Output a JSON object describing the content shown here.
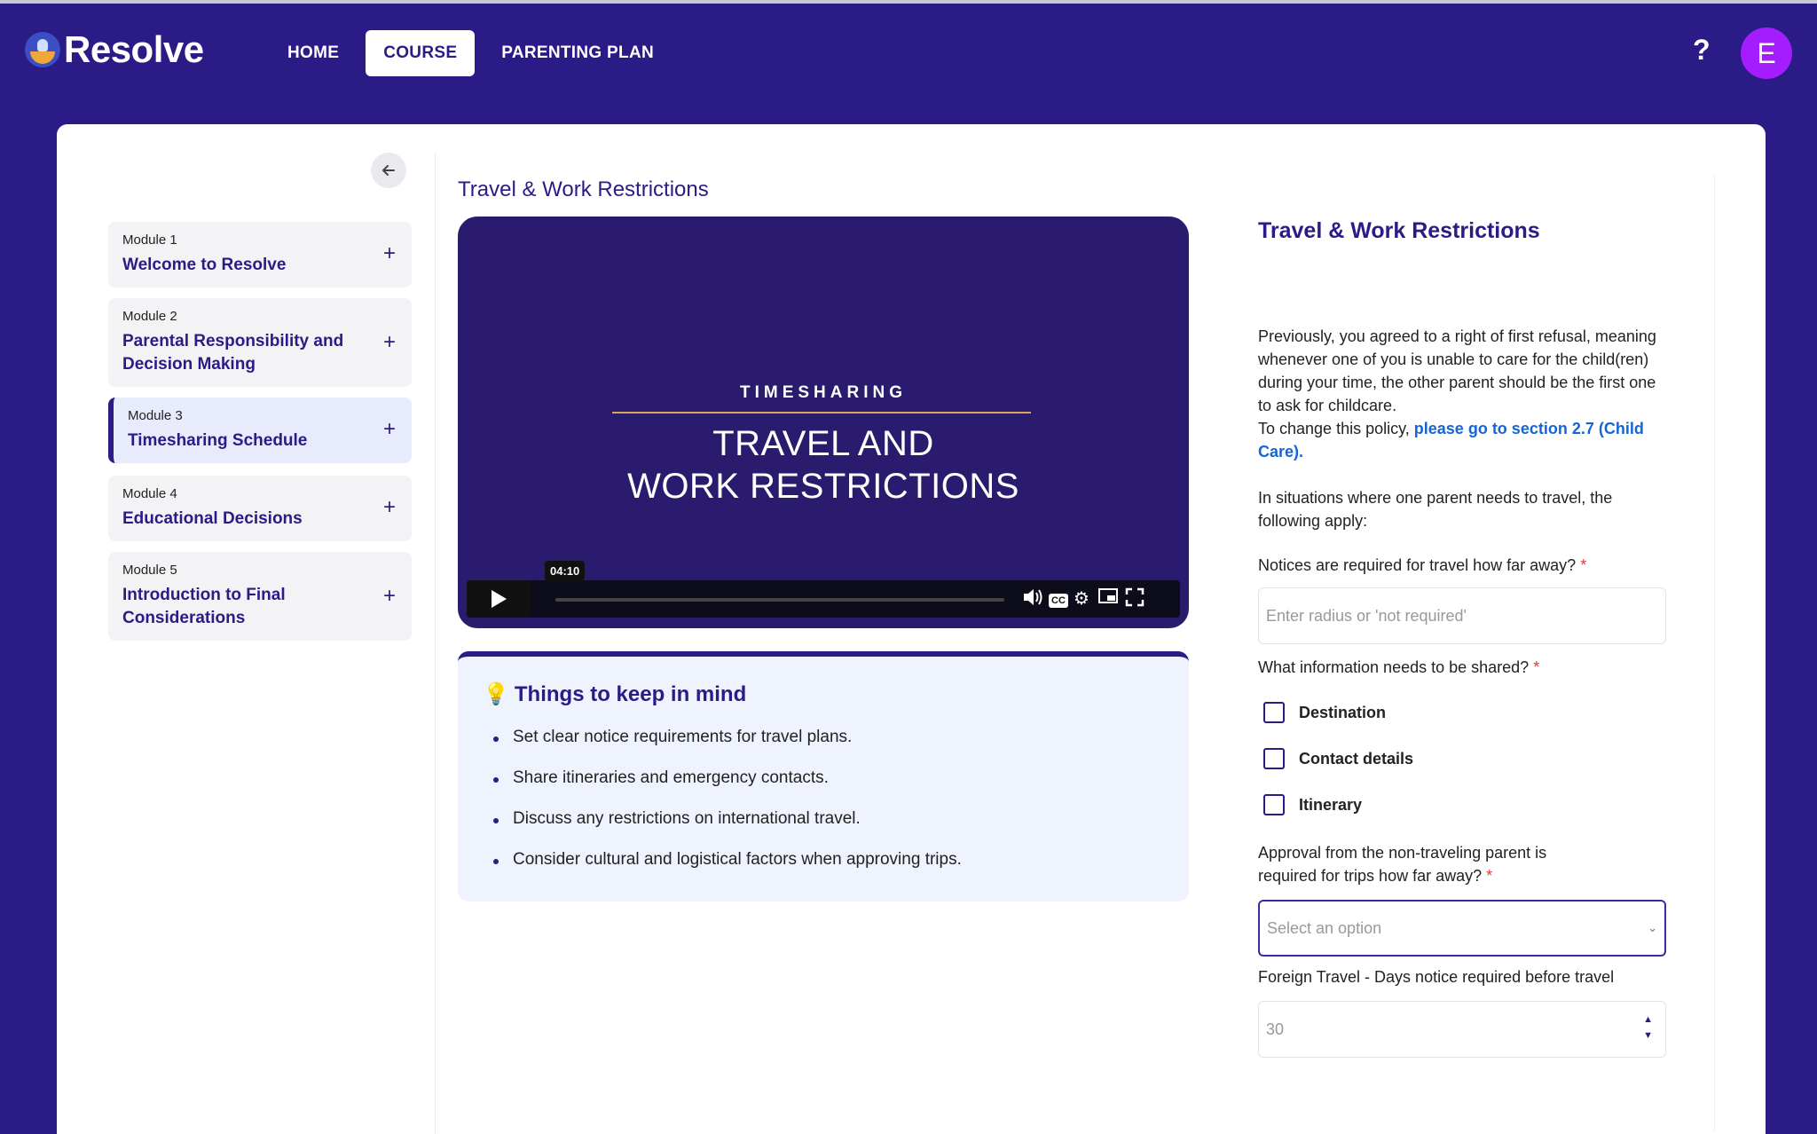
{
  "header": {
    "logo_text": "Resolve",
    "nav": [
      "HOME",
      "COURSE",
      "PARENTING PLAN"
    ],
    "help_label": "?",
    "avatar_initial": "E"
  },
  "sidebar": {
    "modules": [
      {
        "number": "Module 1",
        "title": "Welcome to Resolve"
      },
      {
        "number": "Module 2",
        "title": "Parental Responsibility and Decision Making"
      },
      {
        "number": "Module 3",
        "title": "Timesharing Schedule"
      },
      {
        "number": "Module 4",
        "title": "Educational Decisions"
      },
      {
        "number": "Module 5",
        "title": "Introduction to Final Considerations"
      }
    ],
    "active_module": 3
  },
  "main": {
    "section_title": "Travel & Work Restrictions",
    "video": {
      "subtitle": "TIMESHARING",
      "title_line1": "TRAVEL AND",
      "title_line2": "WORK RESTRICTIONS",
      "time": "04:10",
      "cc_label": "CC"
    },
    "tips": {
      "title": "Things to keep in mind",
      "items": [
        "Set clear notice requirements for travel plans.",
        "Share itineraries and emergency contacts.",
        "Discuss any restrictions on international travel.",
        "Consider cultural and logistical factors when approving trips."
      ]
    }
  },
  "form": {
    "title": "Travel & Work Restrictions",
    "intro_1": "Previously, you agreed to a right of first refusal, meaning whenever one of you is unable to care for the child(ren) during your time, the other parent should be the first one to ask for childcare.",
    "intro_2": "To change this policy,",
    "intro_link": "please go to section 2.7 (Child Care).",
    "intro_3": "In situations where one parent needs to travel, the following apply:",
    "notice_label": "Notices are required for travel how far away?",
    "notice_placeholder": "Enter radius or 'not required'",
    "info_label": "What information needs to be shared?",
    "checkboxes": [
      "Destination",
      "Contact details",
      "Itinerary"
    ],
    "approval_label": "Approval from the non-traveling parent is required for trips how far away?",
    "approval_placeholder": "Select an option",
    "foreign_label": "Foreign Travel - Days notice required before travel",
    "foreign_value": "30",
    "required_mark": "*"
  },
  "colors": {
    "brand": "#2b1b86",
    "avatar": "#a31dff",
    "link": "#1565d8",
    "required": "#e53935"
  }
}
